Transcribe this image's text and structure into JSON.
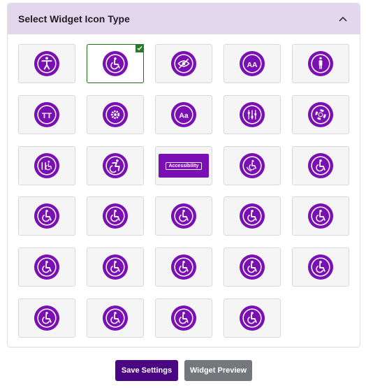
{
  "panel": {
    "title": "Select Widget Icon Type"
  },
  "icons": [
    "accessibility-person-icon",
    "wheelchair-icon",
    "eye-slash-icon",
    "font-size-icon",
    "person-standing-icon",
    "text-size-icon",
    "gear-icon",
    "font-aa-icon",
    "sliders-icon",
    "lifebuoy-icon",
    "accessibility-tools-icon",
    "active-wheelchair-icon",
    "accessibility-button",
    "wheelchair-signs-icon",
    "wheelchair-icon",
    "wheelchair-icon",
    "wheelchair-icon",
    "wheelchair-icon",
    "wheelchair-icon",
    "wheelchair-icon",
    "wheelchair-icon",
    "wheelchair-icon",
    "wheelchair-icon",
    "wheelchair-icon",
    "wheelchair-icon",
    "wheelchair-icon",
    "wheelchair-icon",
    "wheelchair-icon",
    "wheelchair-icon"
  ],
  "selected_index": 1,
  "accessibility_label": "Accessibility",
  "accent_color": "#7a0fb4",
  "buttons": {
    "save": "Save Settings",
    "preview": "Widget Preview"
  }
}
